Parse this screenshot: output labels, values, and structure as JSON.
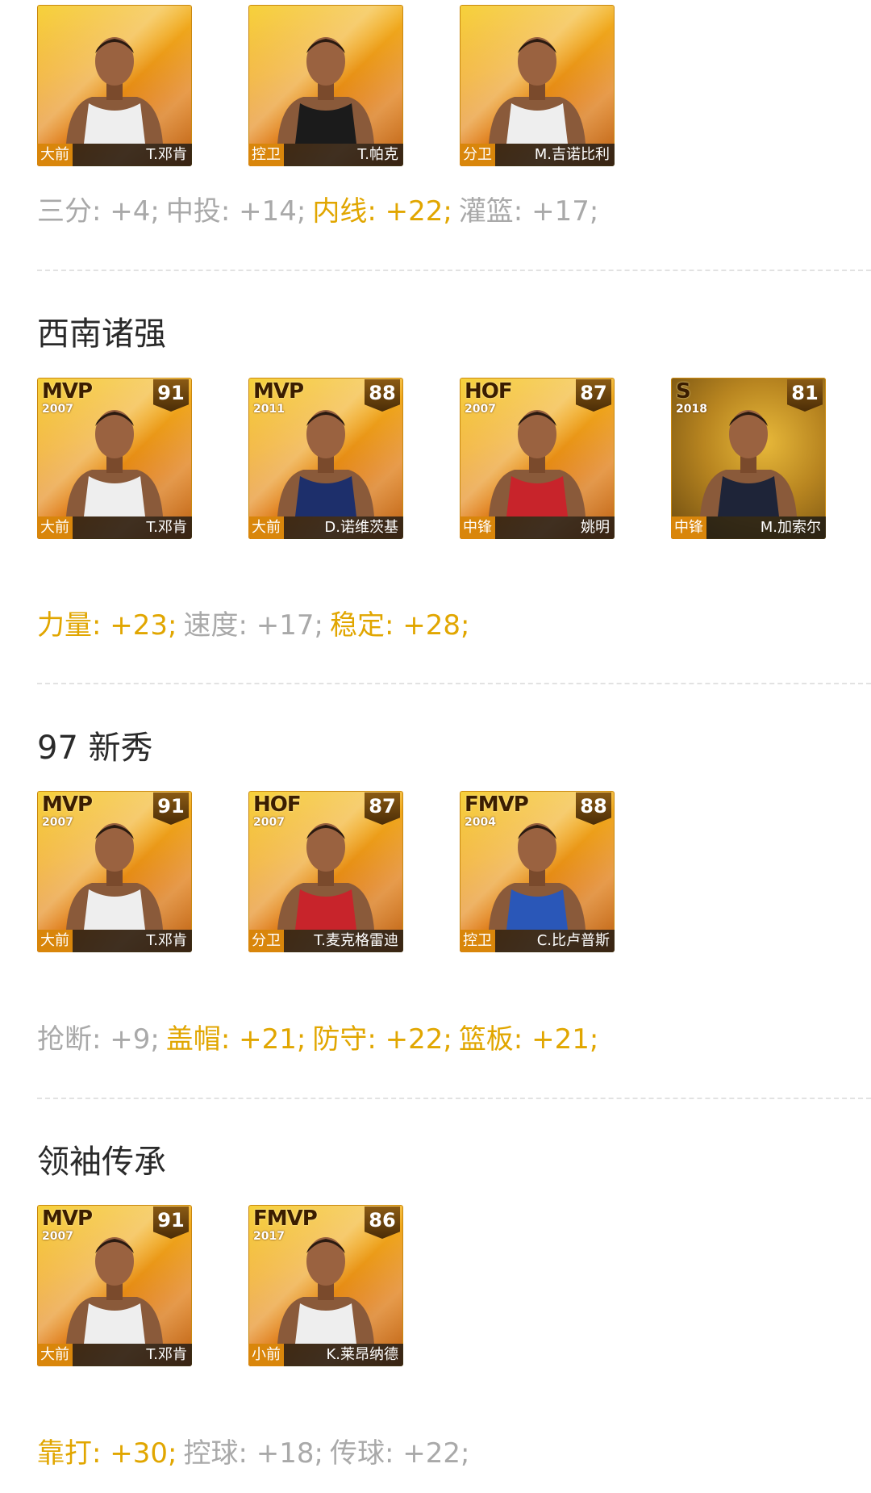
{
  "colors": {
    "accent": "#e1a600",
    "muted": "#a9a9a9",
    "title": "#2a2a2a"
  },
  "sections": [
    {
      "title": "",
      "cards": [
        {
          "badge": "",
          "year": "",
          "rating": "",
          "position": "大前",
          "name": "T.邓肯",
          "jersey": "white"
        },
        {
          "badge": "",
          "year": "",
          "rating": "",
          "position": "控卫",
          "name": "T.帕克",
          "jersey": "black"
        },
        {
          "badge": "",
          "year": "",
          "rating": "",
          "position": "分卫",
          "name": "M.吉诺比利",
          "jersey": "white"
        }
      ],
      "stats": [
        {
          "label": "三分: +4;",
          "highlight": false
        },
        {
          "label": "中投: +14;",
          "highlight": false
        },
        {
          "label": "内线: +22;",
          "highlight": true
        },
        {
          "label": "灌篮: +17;",
          "highlight": false
        }
      ]
    },
    {
      "title": "西南诸强",
      "cards": [
        {
          "badge": "MVP",
          "year": "2007",
          "rating": "91",
          "position": "大前",
          "name": "T.邓肯",
          "jersey": "white"
        },
        {
          "badge": "MVP",
          "year": "2011",
          "rating": "88",
          "position": "大前",
          "name": "D.诺维茨基",
          "jersey": "navy"
        },
        {
          "badge": "HOF",
          "year": "2007",
          "rating": "87",
          "position": "中锋",
          "name": "姚明",
          "jersey": "red"
        },
        {
          "badge": "S",
          "year": "2018",
          "rating": "81",
          "position": "中锋",
          "name": "M.加索尔",
          "jersey": "darknavy"
        }
      ],
      "stats": [
        {
          "label": "力量: +23;",
          "highlight": true
        },
        {
          "label": "速度: +17;",
          "highlight": false
        },
        {
          "label": "稳定: +28;",
          "highlight": true
        }
      ]
    },
    {
      "title": "97 新秀",
      "cards": [
        {
          "badge": "MVP",
          "year": "2007",
          "rating": "91",
          "position": "大前",
          "name": "T.邓肯",
          "jersey": "white"
        },
        {
          "badge": "HOF",
          "year": "2007",
          "rating": "87",
          "position": "分卫",
          "name": "T.麦克格雷迪",
          "jersey": "red"
        },
        {
          "badge": "FMVP",
          "year": "2004",
          "rating": "88",
          "position": "控卫",
          "name": "C.比卢普斯",
          "jersey": "blue"
        }
      ],
      "stats": [
        {
          "label": "抢断: +9;",
          "highlight": false
        },
        {
          "label": "盖帽: +21;",
          "highlight": true
        },
        {
          "label": "防守: +22;",
          "highlight": true
        },
        {
          "label": "篮板: +21;",
          "highlight": true
        }
      ]
    },
    {
      "title": "领袖传承",
      "cards": [
        {
          "badge": "MVP",
          "year": "2007",
          "rating": "91",
          "position": "大前",
          "name": "T.邓肯",
          "jersey": "white"
        },
        {
          "badge": "FMVP",
          "year": "2017",
          "rating": "86",
          "position": "小前",
          "name": "K.莱昂纳德",
          "jersey": "white"
        }
      ],
      "stats": [
        {
          "label": "靠打: +30;",
          "highlight": true
        },
        {
          "label": "控球: +18;",
          "highlight": false
        },
        {
          "label": "传球: +22;",
          "highlight": false
        }
      ]
    }
  ]
}
